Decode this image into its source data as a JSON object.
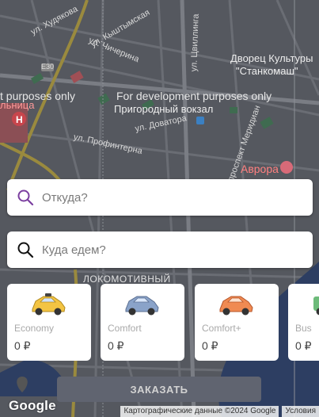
{
  "map": {
    "dev_watermark": "For development purposes only",
    "dev_watermark_left": "t purposes only",
    "streets": {
      "hudyakova": "ул. Худякова",
      "kyshtymskaya": "ул. Кыштымская",
      "chicherina": "ул. Чичерина",
      "tsvillinga": "ул. Цвиллинга",
      "dovatora": "ул. Доватора",
      "profinterna": "ул. Профинтерна",
      "meridian": "проспект Меридиан"
    },
    "road_badge": "E30",
    "poi": {
      "palace": "Дворец Культуры",
      "palace2": "\"Станкомаш\"",
      "station": "Пригородный вокзал",
      "avrora": "Аврора",
      "lokomotivny": "ЛОКОМОТИВНЫЙ",
      "bolnitsa": "льница"
    }
  },
  "search": {
    "from_placeholder": "Откуда?",
    "to_placeholder": "Куда едем?"
  },
  "tariffs": [
    {
      "name": "Economy",
      "price": "0 ₽",
      "car_color": "#f3c443"
    },
    {
      "name": "Comfort",
      "price": "0 ₽",
      "car_color": "#8aa3c9"
    },
    {
      "name": "Comfort+",
      "price": "0 ₽",
      "car_color": "#f08a52"
    },
    {
      "name": "Bus",
      "price": "0 ₽",
      "car_color": "#6dbb7a"
    }
  ],
  "order_button": "ЗАКАЗАТЬ",
  "google_logo": "Google",
  "attribution": {
    "data": "Картографические данные ©2024 Google",
    "terms": "Условия"
  },
  "colors": {
    "accent_icon": "#7b3fa0",
    "button_bg": "#606470"
  }
}
